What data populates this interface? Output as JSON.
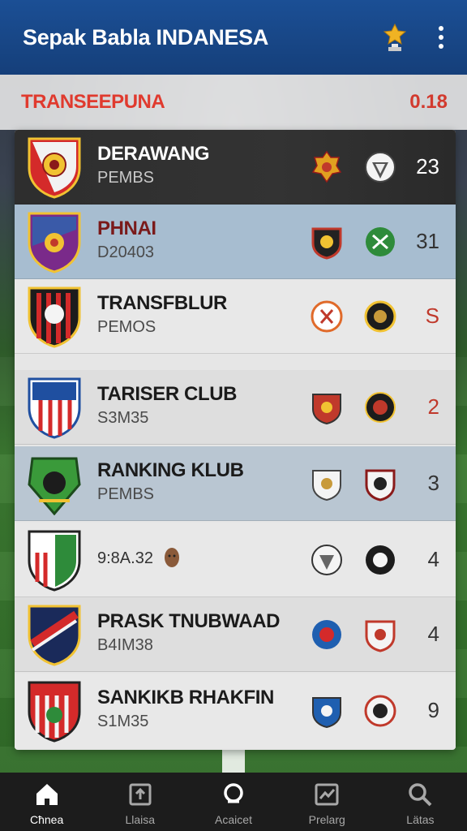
{
  "header": {
    "title": "Sepak Babla INDANESA",
    "trophy_icon": "trophy-icon",
    "more_icon": "more-vertical-icon"
  },
  "section": {
    "title": "TRANSEEPUNA",
    "value": "0.18"
  },
  "clubs": [
    {
      "name": "DERAWANG",
      "sub": "PEMBS",
      "score": "23",
      "style": "dark"
    },
    {
      "name": "PHNAI",
      "sub": "D20403",
      "score": "31",
      "style": "blue"
    },
    {
      "name": "TRANSFBLUR",
      "sub": "PEMOS",
      "score": "S",
      "style": "light"
    },
    {
      "name": "TARISER CLUB",
      "sub": "S3M35",
      "score": "2",
      "style": "mid"
    },
    {
      "name": "RANKING KLUB",
      "sub": "PEMBS",
      "score": "3",
      "style": "bluegray"
    },
    {
      "name": "",
      "sub": "9:8A.32",
      "score": "4",
      "style": "light"
    },
    {
      "name": "PRASK TNUBWAAD",
      "sub": "B4IM38",
      "score": "4",
      "style": "mid"
    },
    {
      "name": "SANKIKB RHAKFIN",
      "sub": "S1M35",
      "score": "9",
      "style": "light"
    }
  ],
  "nav": [
    {
      "label": "Cħnea",
      "icon": "home-icon",
      "active": true
    },
    {
      "label": "Llaisa",
      "icon": "upload-icon",
      "active": false
    },
    {
      "label": "Acaicet",
      "icon": "search-bubble-icon",
      "active": false
    },
    {
      "label": "Prelarg",
      "icon": "chart-icon",
      "active": false
    },
    {
      "label": "Lätas",
      "icon": "search-icon",
      "active": false
    }
  ],
  "colors": {
    "header": "#1b4f95",
    "accent_red": "#e03a2e",
    "nav_bg": "#1c1c1c"
  }
}
